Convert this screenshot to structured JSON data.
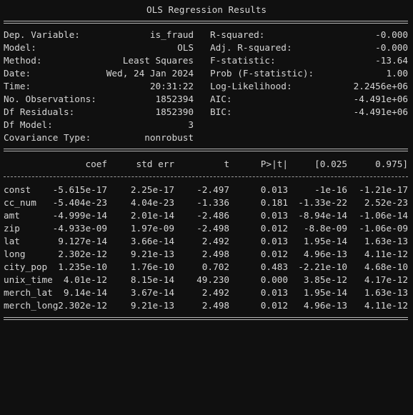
{
  "title": "OLS Regression Results",
  "summary": [
    {
      "label": "Dep. Variable:",
      "value": "is_fraud",
      "label2": "R-squared:",
      "value2": "-0.000"
    },
    {
      "label": "Model:",
      "value": "OLS",
      "label2": "Adj. R-squared:",
      "value2": "-0.000"
    },
    {
      "label": "Method:",
      "value": "Least Squares",
      "label2": "F-statistic:",
      "value2": "-13.64"
    },
    {
      "label": "Date:",
      "value": "Wed, 24 Jan 2024",
      "label2": "Prob (F-statistic):",
      "value2": "1.00"
    },
    {
      "label": "Time:",
      "value": "20:31:22",
      "label2": "Log-Likelihood:",
      "value2": "2.2456e+06"
    },
    {
      "label": "No. Observations:",
      "value": "1852394",
      "label2": "AIC:",
      "value2": "-4.491e+06"
    },
    {
      "label": "Df Residuals:",
      "value": "1852390",
      "label2": "BIC:",
      "value2": "-4.491e+06"
    },
    {
      "label": "Df Model:",
      "value": "3",
      "label2": "",
      "value2": ""
    },
    {
      "label": "Covariance Type:",
      "value": "nonrobust",
      "label2": "",
      "value2": ""
    }
  ],
  "coef_headers": [
    "coef",
    "std err",
    "t",
    "P>|t|",
    "[0.025",
    "0.975]"
  ],
  "coef_rows": [
    {
      "name": "const",
      "coef": "-5.615e-17",
      "std_err": "2.25e-17",
      "t": "-2.497",
      "p": "0.013",
      "lo": "-1e-16",
      "hi": "-1.21e-17"
    },
    {
      "name": "cc_num",
      "coef": "-5.404e-23",
      "std_err": "4.04e-23",
      "t": "-1.336",
      "p": "0.181",
      "lo": "-1.33e-22",
      "hi": "2.52e-23"
    },
    {
      "name": "amt",
      "coef": "-4.999e-14",
      "std_err": "2.01e-14",
      "t": "-2.486",
      "p": "0.013",
      "lo": "-8.94e-14",
      "hi": "-1.06e-14"
    },
    {
      "name": "zip",
      "coef": "-4.933e-09",
      "std_err": "1.97e-09",
      "t": "-2.498",
      "p": "0.012",
      "lo": "-8.8e-09",
      "hi": "-1.06e-09"
    },
    {
      "name": "lat",
      "coef": "9.127e-14",
      "std_err": "3.66e-14",
      "t": "2.492",
      "p": "0.013",
      "lo": "1.95e-14",
      "hi": "1.63e-13"
    },
    {
      "name": "long",
      "coef": "2.302e-12",
      "std_err": "9.21e-13",
      "t": "2.498",
      "p": "0.012",
      "lo": "4.96e-13",
      "hi": "4.11e-12"
    },
    {
      "name": "city_pop",
      "coef": "1.235e-10",
      "std_err": "1.76e-10",
      "t": "0.702",
      "p": "0.483",
      "lo": "-2.21e-10",
      "hi": "4.68e-10"
    },
    {
      "name": "unix_time",
      "coef": "4.01e-12",
      "std_err": "8.15e-14",
      "t": "49.230",
      "p": "0.000",
      "lo": "3.85e-12",
      "hi": "4.17e-12"
    },
    {
      "name": "merch_lat",
      "coef": "9.14e-14",
      "std_err": "3.67e-14",
      "t": "2.492",
      "p": "0.013",
      "lo": "1.95e-14",
      "hi": "1.63e-13"
    },
    {
      "name": "merch_long",
      "coef": "2.302e-12",
      "std_err": "9.21e-13",
      "t": "2.498",
      "p": "0.012",
      "lo": "4.96e-13",
      "hi": "4.11e-12"
    }
  ]
}
